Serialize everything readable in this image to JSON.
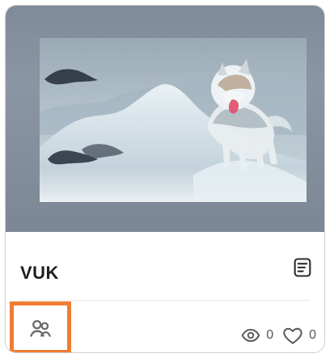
{
  "card": {
    "title": "VUK",
    "stats": {
      "views": "0",
      "likes": "0"
    },
    "icons": {
      "document": "document-icon",
      "owner": "users-icon",
      "views": "eye-icon",
      "likes": "heart-icon"
    },
    "colors": {
      "highlight": "#f07c33",
      "text": "#1f1f1f",
      "muted": "#555555",
      "border": "#cfcfcf"
    }
  }
}
